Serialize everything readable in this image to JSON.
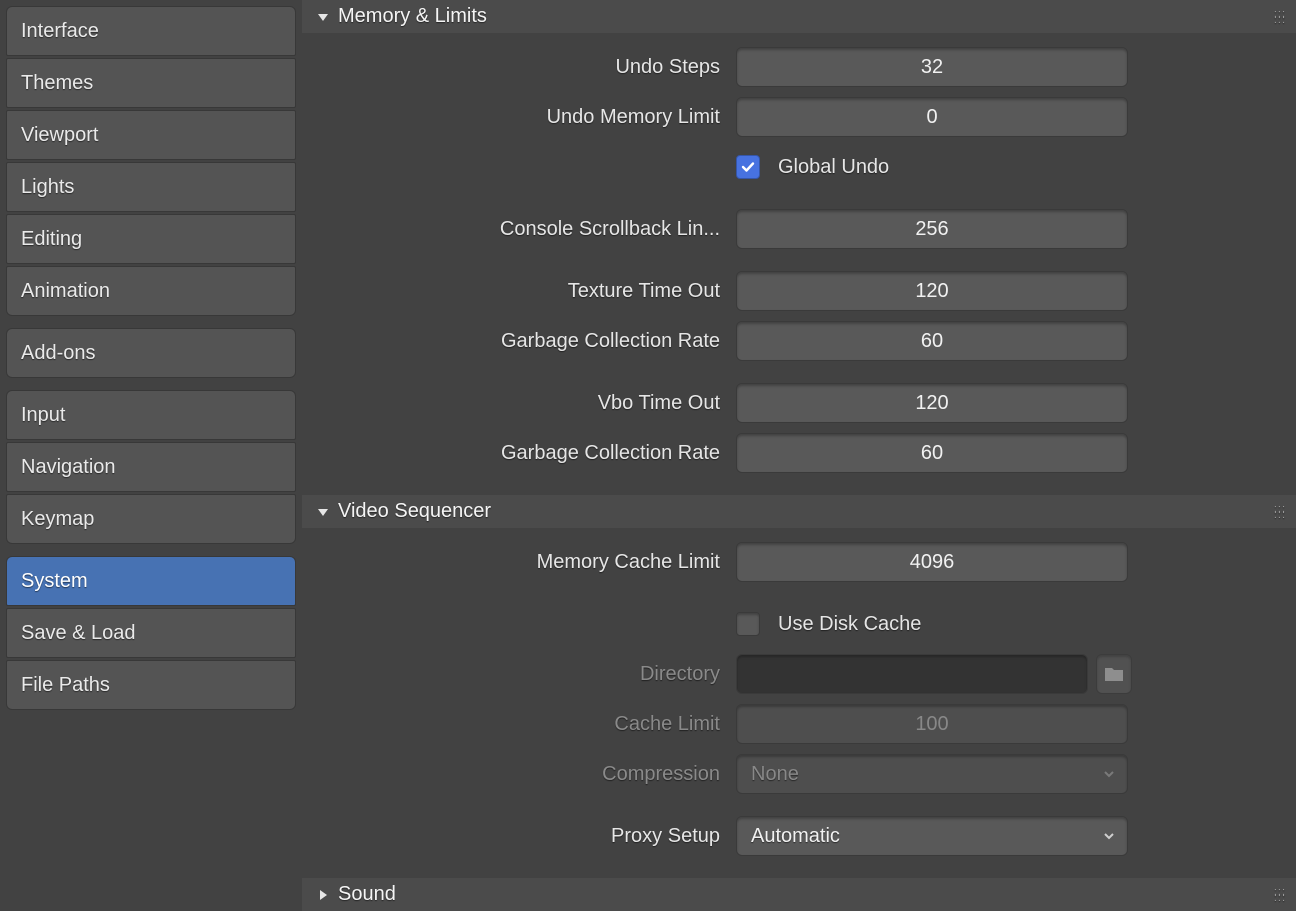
{
  "sidebar": {
    "group1": [
      {
        "label": "Interface"
      },
      {
        "label": "Themes"
      },
      {
        "label": "Viewport"
      },
      {
        "label": "Lights"
      },
      {
        "label": "Editing"
      },
      {
        "label": "Animation"
      }
    ],
    "group2": [
      {
        "label": "Add-ons"
      }
    ],
    "group3": [
      {
        "label": "Input"
      },
      {
        "label": "Navigation"
      },
      {
        "label": "Keymap"
      }
    ],
    "group4": [
      {
        "label": "System"
      },
      {
        "label": "Save & Load"
      },
      {
        "label": "File Paths"
      }
    ],
    "active": "System"
  },
  "panels": {
    "memory": {
      "title": "Memory & Limits",
      "expanded": true,
      "props": {
        "undo_steps_label": "Undo Steps",
        "undo_steps_value": "32",
        "undo_memory_label": "Undo Memory Limit",
        "undo_memory_value": "0",
        "global_undo_label": "Global Undo",
        "global_undo_checked": true,
        "console_lines_label": "Console Scrollback Lin...",
        "console_lines_value": "256",
        "texture_timeout_label": "Texture Time Out",
        "texture_timeout_value": "120",
        "tex_gc_rate_label": "Garbage Collection Rate",
        "tex_gc_rate_value": "60",
        "vbo_timeout_label": "Vbo Time Out",
        "vbo_timeout_value": "120",
        "vbo_gc_rate_label": "Garbage Collection Rate",
        "vbo_gc_rate_value": "60"
      }
    },
    "video": {
      "title": "Video Sequencer",
      "expanded": true,
      "props": {
        "mem_cache_label": "Memory Cache Limit",
        "mem_cache_value": "4096",
        "use_disk_cache_label": "Use Disk Cache",
        "use_disk_cache_checked": false,
        "directory_label": "Directory",
        "directory_value": "",
        "cache_limit_label": "Cache Limit",
        "cache_limit_value": "100",
        "compression_label": "Compression",
        "compression_value": "None",
        "proxy_setup_label": "Proxy Setup",
        "proxy_setup_value": "Automatic"
      }
    },
    "sound": {
      "title": "Sound",
      "expanded": false
    }
  }
}
